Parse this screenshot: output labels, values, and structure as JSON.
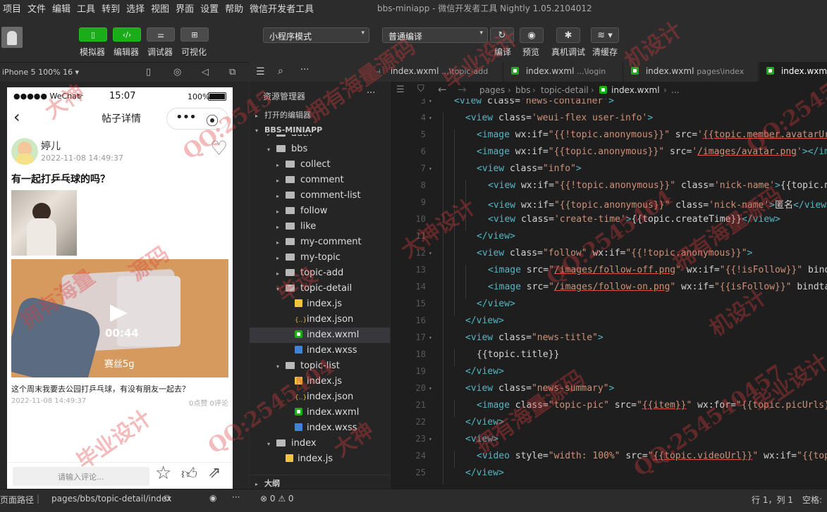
{
  "menu": [
    "项目",
    "文件",
    "编辑",
    "工具",
    "转到",
    "选择",
    "视图",
    "界面",
    "设置",
    "帮助",
    "微信开发者工具"
  ],
  "window_title": "bbs-miniapp  -  微信开发者工具 Nightly 1.05.2104012",
  "toolbar": {
    "simulator": "模拟器",
    "editor": "编辑器",
    "debugger": "调试器",
    "visual": "可视化",
    "mode": "小程序模式",
    "compile_mode": "普通编译",
    "compile": "编译",
    "preview": "预览",
    "real_debug": "真机调试",
    "clear_cache": "清缓存"
  },
  "sim": {
    "device": "iPhone 5 100% 16 ▾",
    "carrier": "●●●●● WeChat",
    "time": "15:07",
    "battery": "100%",
    "page_title": "帖子详情",
    "user_name": "婷儿",
    "post_time": "2022-11-08 14:49:37",
    "post_title": "有一起打乒乓球的吗？",
    "video_time": "00:44",
    "video_caption": "赛丝5g",
    "summary": "这个周末我要去公园打乒乓球，有没有朋友一起去？",
    "summary_time": "2022-11-08 14:49:37",
    "counts": "0点赞 0评论",
    "comment_placeholder": "请输入评论..."
  },
  "explorer": {
    "title": "资源管理器",
    "open_editors": "打开的编辑器",
    "project": "BBS-MINIAPP",
    "outline": "大纲",
    "tree": [
      {
        "name": "auth",
        "type": "folder",
        "depth": 1,
        "open": false
      },
      {
        "name": "bbs",
        "type": "folder",
        "depth": 1,
        "open": true
      },
      {
        "name": "collect",
        "type": "folder",
        "depth": 2,
        "open": false
      },
      {
        "name": "comment",
        "type": "folder",
        "depth": 2,
        "open": false
      },
      {
        "name": "comment-list",
        "type": "folder",
        "depth": 2,
        "open": false
      },
      {
        "name": "follow",
        "type": "folder",
        "depth": 2,
        "open": false
      },
      {
        "name": "like",
        "type": "folder",
        "depth": 2,
        "open": false
      },
      {
        "name": "my-comment",
        "type": "folder",
        "depth": 2,
        "open": false
      },
      {
        "name": "my-topic",
        "type": "folder",
        "depth": 2,
        "open": false
      },
      {
        "name": "topic-add",
        "type": "folder",
        "depth": 2,
        "open": false
      },
      {
        "name": "topic-detail",
        "type": "folder",
        "depth": 2,
        "open": true
      },
      {
        "name": "index.js",
        "type": "js",
        "depth": 3
      },
      {
        "name": "index.json",
        "type": "json",
        "depth": 3
      },
      {
        "name": "index.wxml",
        "type": "wxml",
        "depth": 3,
        "selected": true
      },
      {
        "name": "index.wxss",
        "type": "wxss",
        "depth": 3
      },
      {
        "name": "topic-list",
        "type": "folder",
        "depth": 2,
        "open": true
      },
      {
        "name": "index.js",
        "type": "js",
        "depth": 3
      },
      {
        "name": "index.json",
        "type": "json",
        "depth": 3
      },
      {
        "name": "index.wxml",
        "type": "wxml",
        "depth": 3
      },
      {
        "name": "index.wxss",
        "type": "wxss",
        "depth": 3
      },
      {
        "name": "index",
        "type": "folder",
        "depth": 1,
        "open": true
      },
      {
        "name": "index.js",
        "type": "js",
        "depth": 2
      }
    ]
  },
  "tabs": [
    {
      "name": "index.wxml",
      "path": "...\\topic-add",
      "active": false
    },
    {
      "name": "index.wxml",
      "path": "...\\login",
      "active": false
    },
    {
      "name": "index.wxml",
      "path": "pages\\index",
      "active": false
    },
    {
      "name": "index.wxml",
      "path": "",
      "active": true
    }
  ],
  "breadcrumbs": [
    "pages",
    "bbs",
    "topic-detail",
    "index.wxml",
    "..."
  ],
  "code_lines": [
    {
      "n": "3",
      "html": "<span class='t'>&lt;view</span> <span class='a'>class=</span><span class='s'>'news-container'</span><span class='t'>&gt;</span>",
      "indent": 0,
      "fold": true
    },
    {
      "n": "4",
      "html": "<span class='t'>&lt;view</span> <span class='a'>class=</span><span class='s'>'weui-flex user-info'</span><span class='t'>&gt;</span>",
      "indent": 1,
      "fold": true
    },
    {
      "n": "5",
      "html": "<span class='t'>&lt;image</span> <span class='a'>wx:if=</span><span class='s'>\"{{!topic.anonymous}}\"</span> <span class='a'>src=</span><span class='s'>'</span><span class='u'>{{topic.member.avatarUrl</span>",
      "indent": 2,
      "fold": false
    },
    {
      "n": "6",
      "html": "<span class='t'>&lt;image</span> <span class='a'>wx:if=</span><span class='s'>\"{{topic.anonymous}}\"</span> <span class='a'>src=</span><span class='s'>'</span><span class='u'>/images/avatar.png</span><span class='s'>'</span><span class='t'>&gt;&lt;/ima</span>",
      "indent": 2,
      "fold": false
    },
    {
      "n": "7",
      "html": "<span class='t'>&lt;view</span> <span class='a'>class=</span><span class='s'>\"info\"</span><span class='t'>&gt;</span>",
      "indent": 2,
      "fold": true
    },
    {
      "n": "8",
      "html": "<span class='t'>&lt;view</span> <span class='a'>wx:if=</span><span class='s'>\"{{!topic.anonymous}}\"</span> <span class='a'>class=</span><span class='s'>'nick-name'</span><span class='t'>&gt;</span>{{topic.me",
      "indent": 3,
      "fold": false
    },
    {
      "n": "9",
      "html": "<span class='t'>&lt;view</span> <span class='a'>wx:if=</span><span class='s'>\"{{topic.anonymous}}\"</span> <span class='a'>class=</span><span class='s'>'nick-name'</span><span class='t'>&gt;</span>匿名<span class='t'>&lt;/view&gt;</span>",
      "indent": 3,
      "fold": false
    },
    {
      "n": "10",
      "html": "<span class='t'>&lt;view</span> <span class='a'>class=</span><span class='s'>'create-time'</span><span class='t'>&gt;</span>{{topic.createTime}}<span class='t'>&lt;/view&gt;</span>",
      "indent": 3,
      "fold": false
    },
    {
      "n": "11",
      "html": "<span class='t'>&lt;/view&gt;</span>",
      "indent": 2,
      "fold": false
    },
    {
      "n": "12",
      "html": "<span class='t'>&lt;view</span> <span class='a'>class=</span><span class='s'>\"follow\"</span> <span class='a'>wx:if=</span><span class='s'>\"{{!topic.anonymous}}\"</span><span class='t'>&gt;</span>",
      "indent": 2,
      "fold": true
    },
    {
      "n": "13",
      "html": "<span class='t'>&lt;image</span> <span class='a'>src=</span><span class='s'>\"</span><span class='u'>/images/follow-off.png</span><span class='s'>\"</span> <span class='a'>wx:if=</span><span class='s'>\"{{!isFollow}}\"</span> bindt",
      "indent": 3,
      "fold": false
    },
    {
      "n": "14",
      "html": "<span class='t'>&lt;image</span> <span class='a'>src=</span><span class='s'>\"</span><span class='u'>/images/follow-on.png</span><span class='s'>\"</span> <span class='a'>wx:if=</span><span class='s'>\"{{isFollow}}\"</span> bindtap",
      "indent": 3,
      "fold": false
    },
    {
      "n": "15",
      "html": "<span class='t'>&lt;/view&gt;</span>",
      "indent": 2,
      "fold": false
    },
    {
      "n": "16",
      "html": "<span class='t'>&lt;/view&gt;</span>",
      "indent": 1,
      "fold": false
    },
    {
      "n": "17",
      "html": "<span class='t'>&lt;view</span> <span class='a'>class=</span><span class='s'>\"news-title\"</span><span class='t'>&gt;</span>",
      "indent": 1,
      "fold": true
    },
    {
      "n": "18",
      "html": "{{topic.title}}",
      "indent": 2,
      "fold": false
    },
    {
      "n": "19",
      "html": "<span class='t'>&lt;/view&gt;</span>",
      "indent": 1,
      "fold": false
    },
    {
      "n": "20",
      "html": "<span class='t'>&lt;view</span> <span class='a'>class=</span><span class='s'>\"news-summary\"</span><span class='t'>&gt;</span>",
      "indent": 1,
      "fold": true
    },
    {
      "n": "21",
      "html": "<span class='t'>&lt;image</span> <span class='a'>class=</span><span class='s'>\"topic-pic\"</span> <span class='a'>src=</span><span class='s'>\"</span><span class='u'>{{item}}</span><span class='s'>\"</span> <span class='a'>wx:for=</span><span class='s'>\"{{topic.picUrls}}</span>",
      "indent": 2,
      "fold": false
    },
    {
      "n": "22",
      "html": "<span class='t'>&lt;/view&gt;</span>",
      "indent": 1,
      "fold": false
    },
    {
      "n": "23",
      "html": "<span class='t'>&lt;view&gt;</span>",
      "indent": 1,
      "fold": true
    },
    {
      "n": "24",
      "html": "<span class='t'>&lt;video</span> <span class='a'>style=</span><span class='s'>\"width: 100%\"</span> <span class='a'>src=</span><span class='s'>\"</span><span class='u'>{{topic.videoUrl}}</span><span class='s'>\"</span> <span class='a'>wx:if=</span><span class='s'>\"{{topi</span>",
      "indent": 2,
      "fold": false
    },
    {
      "n": "25",
      "html": "<span class='t'>&lt;/view&gt;</span>",
      "indent": 1,
      "fold": false
    }
  ],
  "status": {
    "page_path_label": "页面路径",
    "page_path": "pages/bbs/topic-detail/index",
    "problems": "⊗ 0 ⚠ 0",
    "cursor": "行 1，列 1",
    "spaces": "空格:"
  },
  "watermarks": [
    "大神",
    "QQ:2545",
    "拥有海量源码",
    "毕业设计",
    "机设计",
    "QQ:254540457",
    "拥有海量",
    "源码",
    "毕设",
    "大神设计",
    "QQ:2545404",
    "拥有海量源码",
    "毕业设计",
    "QQ:2545404",
    "大神",
    "拥有海量源码",
    "QQ:254540457",
    "毕业设计",
    "机设计"
  ],
  "colors": {
    "accent": "#1aad19",
    "tag": "#56b6c2",
    "string": "#ce9178",
    "bg": "#1e1e1e"
  }
}
